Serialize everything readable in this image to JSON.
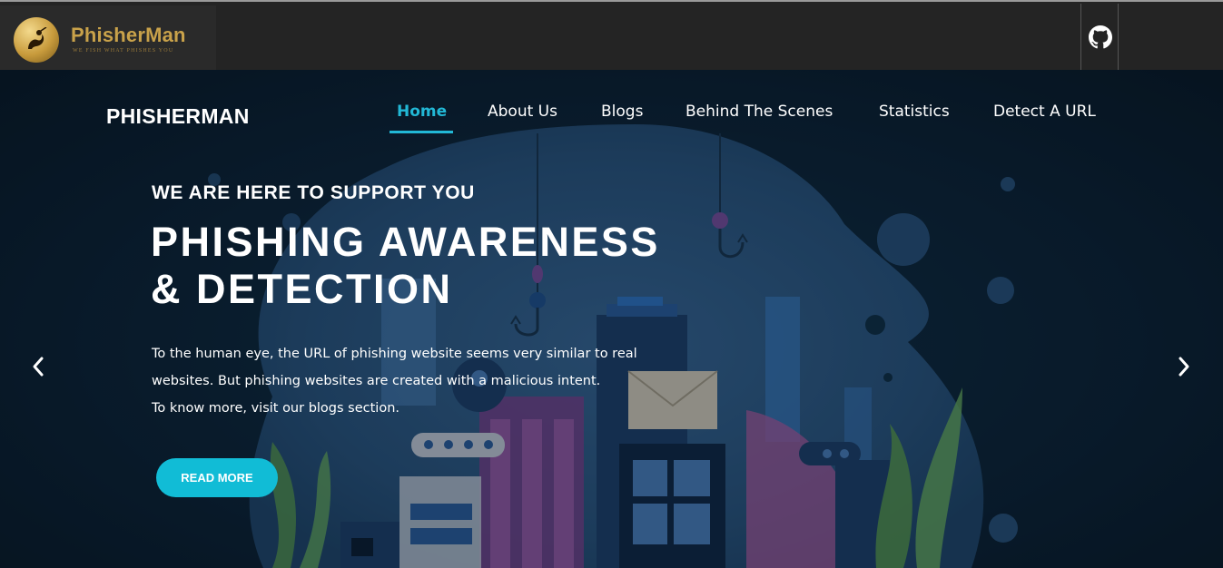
{
  "topbar": {
    "logo_title": "PhisherMan",
    "logo_tagline": "WE FISH WHAT PHISHES YOU",
    "github_icon": "github-icon"
  },
  "hero": {
    "brand": "PHISHERMAN",
    "nav": [
      {
        "label": "Home",
        "active": true
      },
      {
        "label": "About Us",
        "active": false
      },
      {
        "label": "Blogs",
        "active": false
      },
      {
        "label": "Behind The Scenes",
        "active": false
      },
      {
        "label": "Statistics",
        "active": false
      },
      {
        "label": "Detect A URL",
        "active": false
      }
    ],
    "sub_heading": "WE ARE HERE TO SUPPORT YOU",
    "heading_line1": "PHISHING AWARENESS",
    "heading_line2": "& DETECTION",
    "description": [
      "To the human eye, the URL of phishing website seems very similar to real",
      "websites. But phishing websites are created with a malicious intent.",
      "To know more, visit our blogs section."
    ],
    "button_label": "READ MORE",
    "prev_icon": "chevron-left-icon",
    "next_icon": "chevron-right-icon"
  },
  "colors": {
    "accent": "#22b8d6",
    "button": "#11bcd6",
    "topbar": "#242424",
    "logo_gold": "#c9a24a"
  }
}
